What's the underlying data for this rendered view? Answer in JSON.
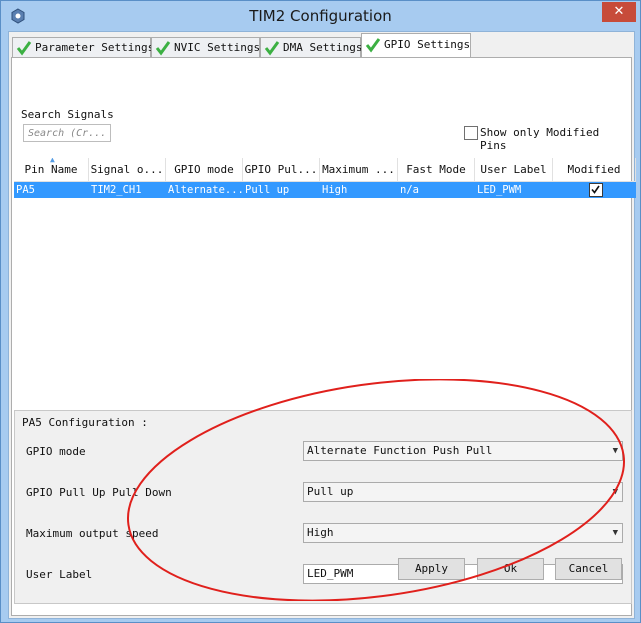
{
  "window": {
    "title": "TIM2 Configuration",
    "close_glyph": "✕"
  },
  "tabs": [
    {
      "label": "Parameter Settings",
      "icon": "green-check-icon",
      "active": false
    },
    {
      "label": "NVIC Settings",
      "icon": "green-check-icon",
      "active": false
    },
    {
      "label": "DMA Settings",
      "icon": "green-check-icon",
      "active": false
    },
    {
      "label": "GPIO Settings",
      "icon": "green-check-icon",
      "active": true
    }
  ],
  "search": {
    "label": "Search Signals",
    "placeholder": "Search (Cr..."
  },
  "filter": {
    "label": "Show only Modified Pins",
    "checked": false
  },
  "table": {
    "columns": [
      "Pin Name",
      "Signal o...",
      "GPIO mode",
      "GPIO Pul...",
      "Maximum ...",
      "Fast Mode",
      "User Label",
      "Modified"
    ],
    "rows": [
      {
        "pin": "PA5",
        "signal": "TIM2_CH1",
        "mode": "Alternate...",
        "pull": "Pull up",
        "speed": "High",
        "fast": "n/a",
        "label": "LED_PWM",
        "modified": true
      }
    ]
  },
  "config": {
    "title": "PA5 Configuration :",
    "gpio_mode": {
      "label": "GPIO mode",
      "value": "Alternate Function Push Pull"
    },
    "pull": {
      "label": "GPIO Pull Up Pull Down",
      "value": "Pull up"
    },
    "speed": {
      "label": "Maximum output speed",
      "value": "High"
    },
    "user_label": {
      "label": "User Label",
      "value": "LED_PWM"
    }
  },
  "buttons": {
    "apply": "Apply",
    "ok": "Ok",
    "cancel": "Cancel"
  },
  "colors": {
    "selection": "#3399ff",
    "check": "#3cb043",
    "annotation": "#e0201c"
  }
}
